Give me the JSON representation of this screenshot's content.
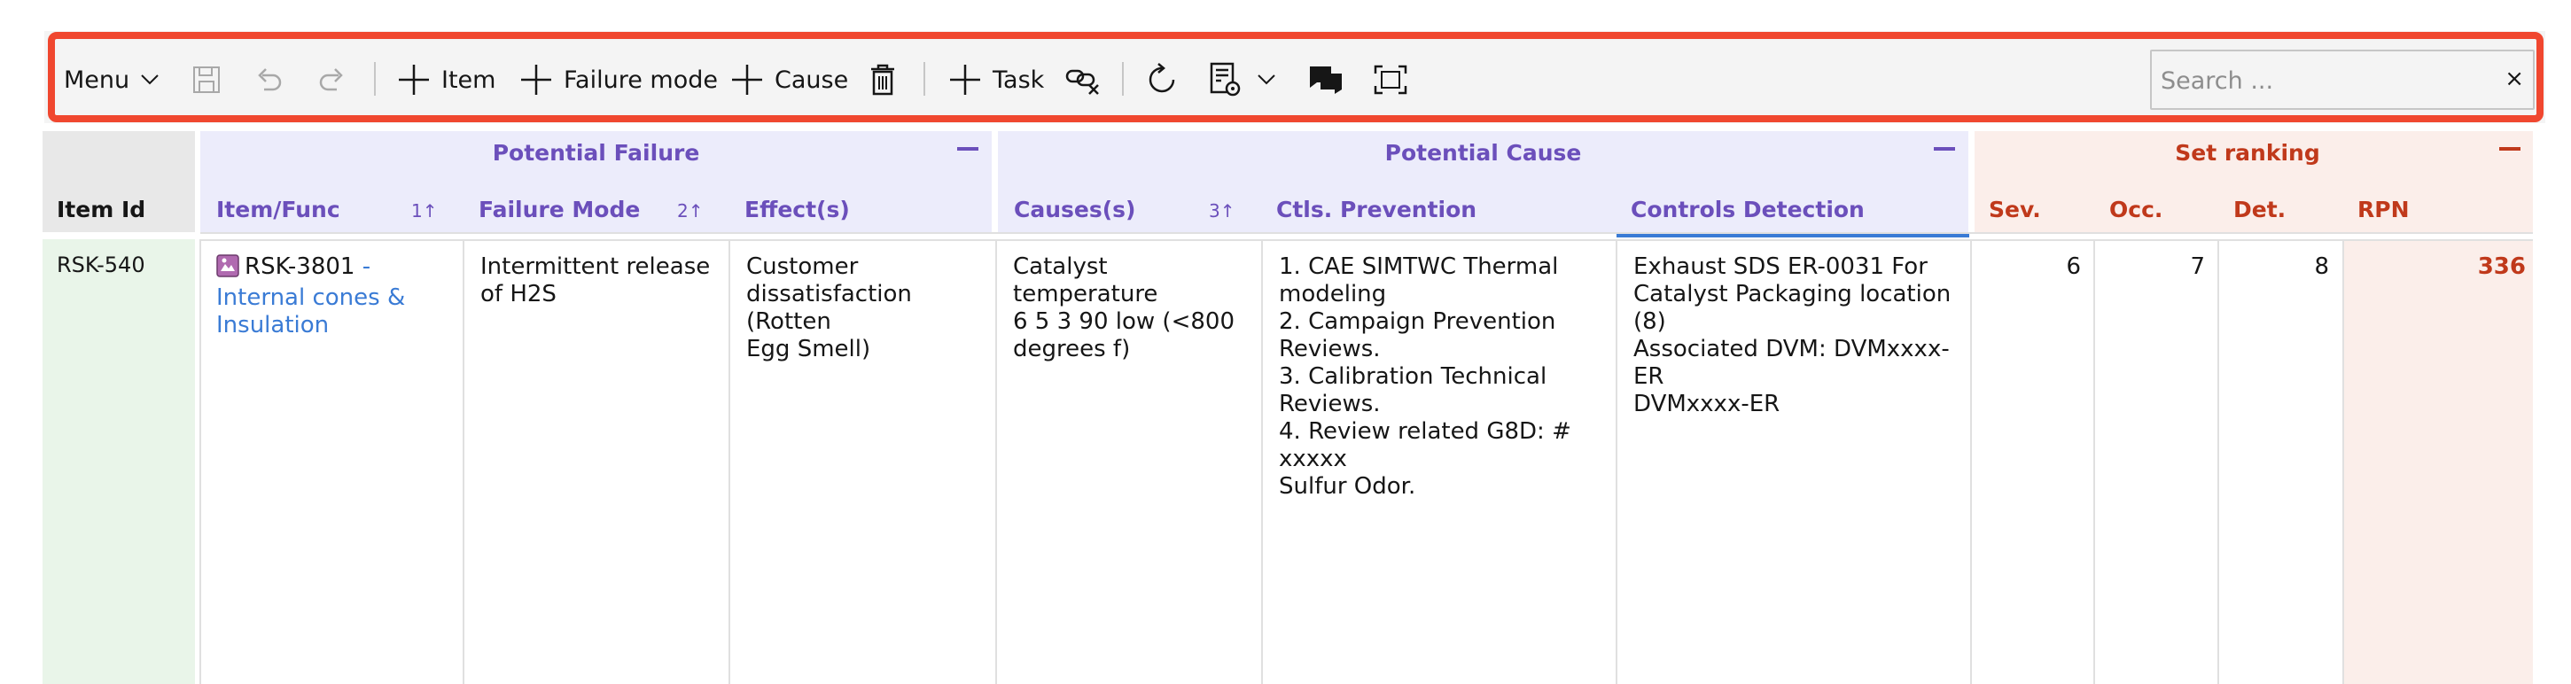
{
  "toolbar": {
    "menu_label": "Menu",
    "add_item_label": "Item",
    "add_failure_mode_label": "Failure mode",
    "add_cause_label": "Cause",
    "add_task_label": "Task",
    "search_placeholder": "Search ...",
    "search_clear": "×"
  },
  "groups": {
    "potential_failure": "Potential Failure",
    "potential_cause": "Potential Cause",
    "set_ranking": "Set ranking"
  },
  "columns": {
    "item_id": "Item Id",
    "item_func": "Item/Func",
    "item_func_sort": "1",
    "failure_mode": "Failure Mode",
    "failure_mode_sort": "2",
    "effects": "Effect(s)",
    "causes": "Causes(s)",
    "causes_sort": "3",
    "ctls_prevention": "Ctls. Prevention",
    "controls_detection": "Controls Detection",
    "sev": "Sev.",
    "occ": "Occ.",
    "det": "Det.",
    "rpn": "RPN"
  },
  "row": {
    "item_id": "RSK-540",
    "item_code": "RSK-3801",
    "item_sep": " - ",
    "item_link_line1": "Internal cones &",
    "item_link_line2": "Insulation",
    "failure_mode": [
      "Intermittent release",
      "of H2S"
    ],
    "effects": [
      "Customer",
      "dissatisfaction (Rotten",
      "Egg Smell)"
    ],
    "causes": [
      "Catalyst temperature",
      "6 5 3 90 low (<800",
      "degrees f)"
    ],
    "prevention": [
      "1. CAE SIMTWC Thermal",
      "modeling",
      "2. Campaign Prevention",
      "Reviews.",
      "3. Calibration Technical",
      "Reviews.",
      "4. Review related G8D: # xxxxx",
      "Sulfur Odor."
    ],
    "detection": [
      "Exhaust SDS ER-0031 For",
      "Catalyst Packaging location (8)",
      "Associated DVM: DVMxxxx-ER",
      "DVMxxxx-ER"
    ],
    "sev": "6",
    "occ": "7",
    "det": "8",
    "rpn": "336"
  },
  "colors": {
    "accent_purple": "#6b4fbb",
    "ranking_red": "#c0391b",
    "link_blue": "#3a7bd5",
    "highlight_orange": "#f0472f"
  }
}
